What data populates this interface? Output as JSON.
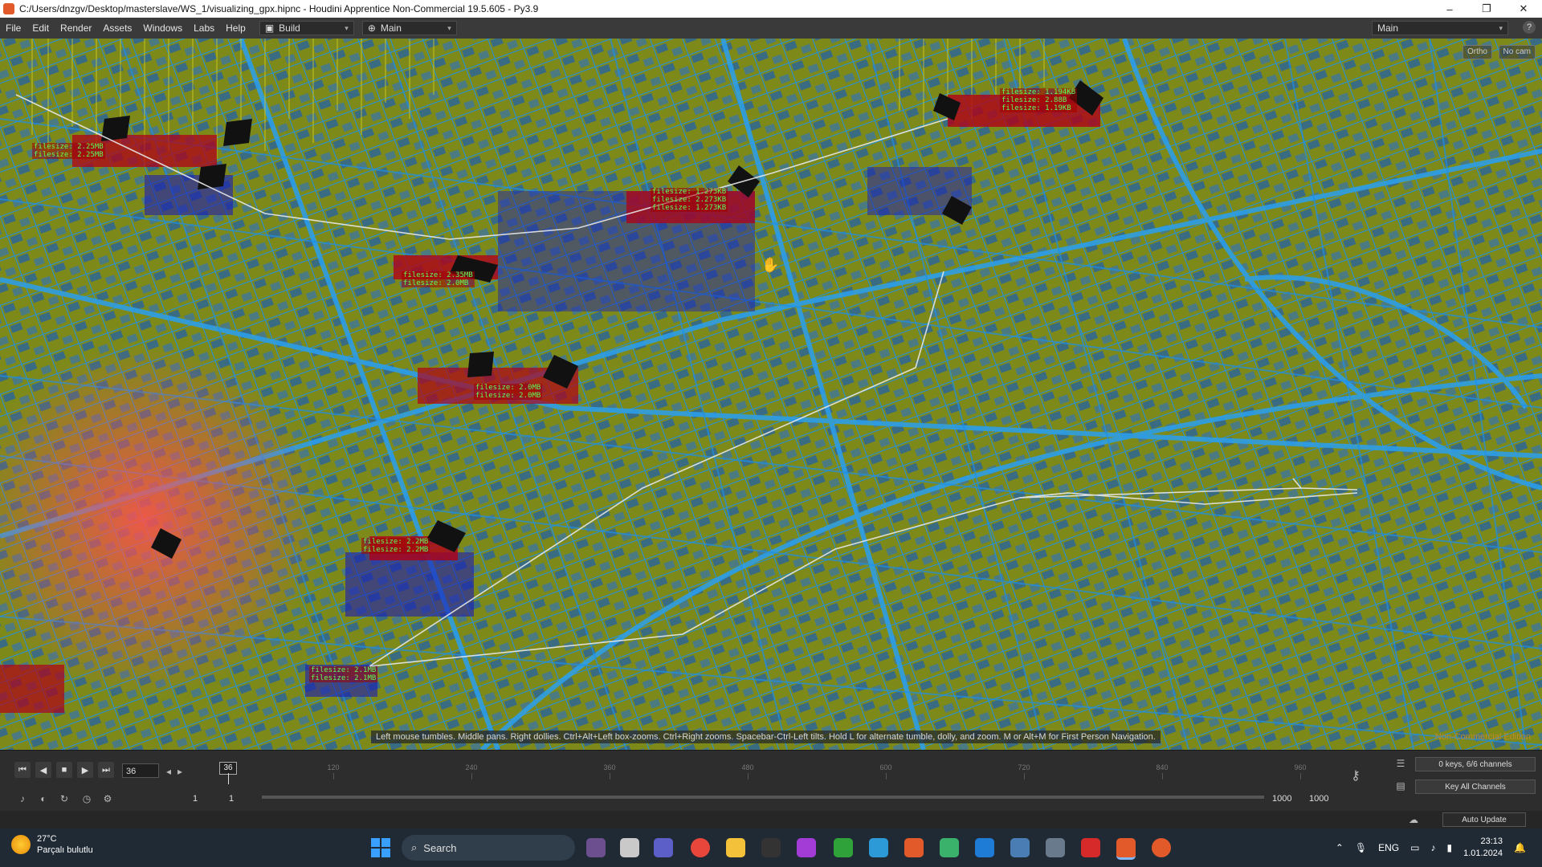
{
  "window": {
    "title": "C:/Users/dnzgv/Desktop/masterslave/WS_1/visualizing_gpx.hipnc - Houdini Apprentice Non-Commercial 19.5.605 - Py3.9",
    "minimize": "–",
    "maximize": "❐",
    "close": "✕"
  },
  "menubar": {
    "items": [
      "File",
      "Edit",
      "Render",
      "Assets",
      "Windows",
      "Labs",
      "Help"
    ],
    "build_desk": "Build",
    "main_desk": "Main",
    "right_desk": "Main",
    "help": "?"
  },
  "viewport": {
    "view_mode": "Ortho",
    "camera": "No cam",
    "hint": "Left mouse tumbles. Middle pans. Right dollies. Ctrl+Alt+Left box-zooms. Ctrl+Right zooms. Spacebar-Ctrl-Left tilts. Hold L for alternate tumble, dolly, and zoom.    M or Alt+M for First Person Navigation.",
    "watermark": "Non-Commercial Edition",
    "colors": {
      "ground": "#7d8a1a",
      "streets": "#1e8fe8",
      "blocks": "#1c5fb0",
      "path": "#e8e8e8",
      "labels": "#5cff5c"
    },
    "label_clusters": [
      [
        "filesize: 1.194KB",
        "filesize: 2.88B",
        "filesize: 1.19KB"
      ],
      [
        "filesize: 1.273KB",
        "filesize: 2.273KB",
        "filesize: 1.273KB"
      ],
      [
        "filesize: 2.35MB",
        "filesize: 2.0MB"
      ],
      [
        "filesize: 2.0MB",
        "filesize: 2.0MB"
      ],
      [
        "filesize: 2.2MB",
        "filesize: 2.2MB"
      ],
      [
        "filesize: 2.1MB",
        "filesize: 2.1MB"
      ],
      [
        "filesize: 2.25MB",
        "filesize: 2.25MB"
      ]
    ]
  },
  "timeline": {
    "current_frame": "36",
    "frame_marker": "36",
    "ticks": [
      "120",
      "240",
      "360",
      "480",
      "600",
      "720",
      "840",
      "960"
    ],
    "range_start": "1",
    "range_start2": "1",
    "range_end": "1000",
    "range_end2": "1000",
    "keys_info": "0 keys, 6/6 channels",
    "key_all": "Key All Channels",
    "auto_update": "Auto Update"
  },
  "taskbar": {
    "temp": "27°C",
    "weather": "Parçalı bulutlu",
    "search": "Search",
    "lang": "ENG",
    "time": "23:13",
    "date": "1.01.2024"
  }
}
